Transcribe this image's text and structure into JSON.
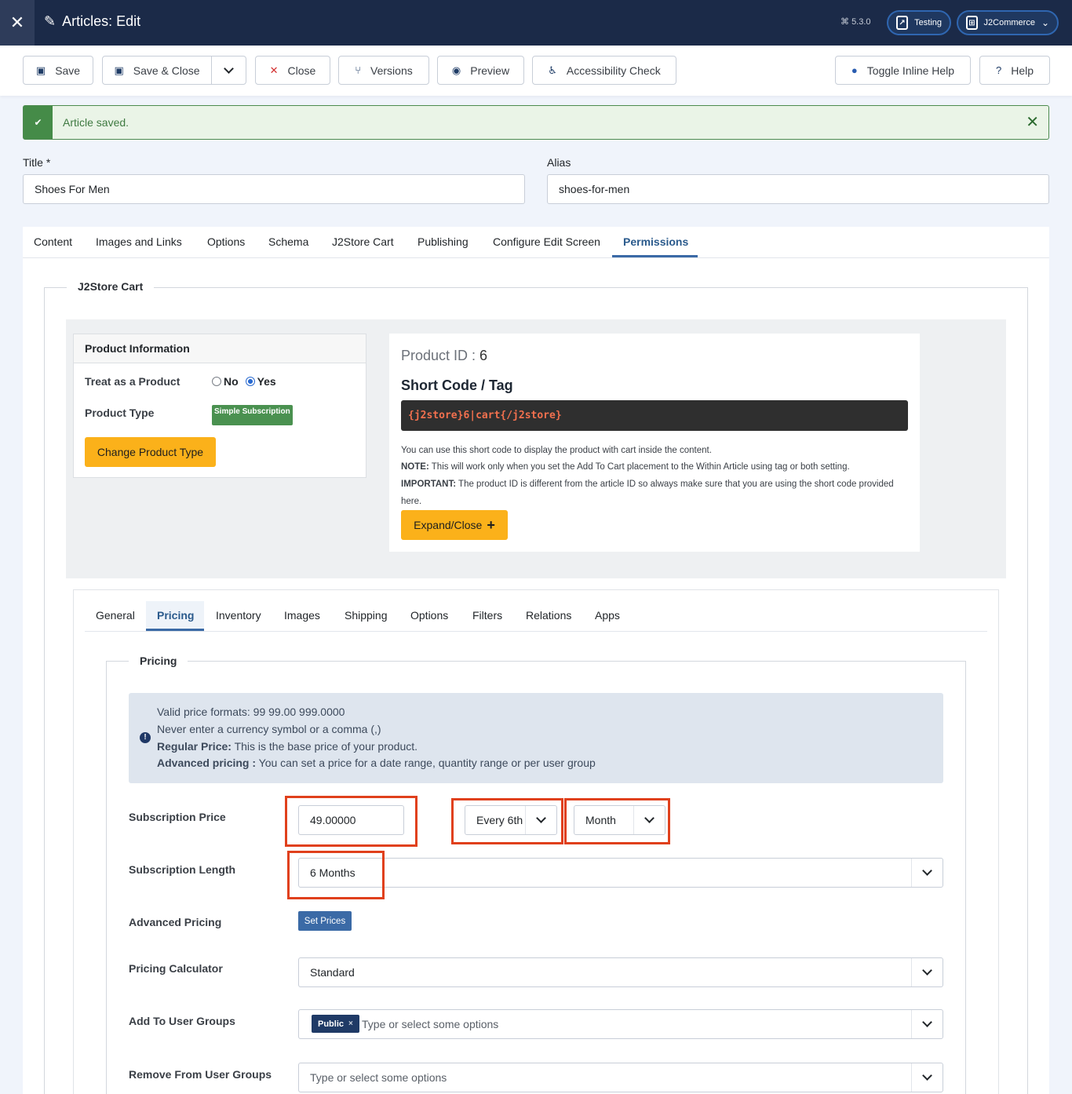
{
  "header": {
    "title": "Articles: Edit",
    "version": "5.3.0",
    "site_button": "Testing",
    "user_menu": "J2Commerce"
  },
  "toolbar": {
    "save": "Save",
    "save_close": "Save & Close",
    "close": "Close",
    "versions": "Versions",
    "preview": "Preview",
    "accessibility": "Accessibility Check",
    "inline_help": "Toggle Inline Help",
    "help": "Help"
  },
  "alert": {
    "message": "Article saved."
  },
  "form": {
    "title_label": "Title *",
    "title_value": "Shoes For Men",
    "alias_label": "Alias",
    "alias_value": "shoes-for-men"
  },
  "tabs": [
    "Content",
    "Images and Links",
    "Options",
    "Schema",
    "J2Store Cart",
    "Publishing",
    "Configure Edit Screen",
    "Permissions"
  ],
  "j2store": {
    "legend": "J2Store Cart",
    "product_info": {
      "heading": "Product Information",
      "treat_label": "Treat as a Product",
      "no": "No",
      "yes": "Yes",
      "type_label": "Product Type",
      "type_value": "Simple Subscription",
      "change_button": "Change Product Type"
    },
    "shortcode": {
      "product_id_label": "Product ID : ",
      "product_id": "6",
      "heading": "Short Code / Tag",
      "code": "{j2store}6|cart{/j2store}",
      "line1": "You can use this short code to display the product with cart inside the content.",
      "note_label": "NOTE:",
      "note": " This will work only when you set the Add To Cart placement to the Within Article using tag or both setting.",
      "important_label": "IMPORTANT:",
      "important": " The product ID is different from the article ID so always make sure that you are using the short code provided",
      "important_cont": "here.",
      "expand_button": "Expand/Close"
    }
  },
  "subtabs": [
    "General",
    "Pricing",
    "Inventory",
    "Images",
    "Shipping",
    "Options",
    "Filters",
    "Relations",
    "Apps"
  ],
  "pricing": {
    "legend": "Pricing",
    "info": {
      "line1": "Valid price formats: 99 99.00 999.0000",
      "line2": "Never enter a currency symbol or a comma (,)",
      "line3_bold": "Regular Price:",
      "line3": " This is the base price of your product.",
      "line4_bold": "Advanced pricing :",
      "line4": " You can set a price for a date range, quantity range or per user group"
    },
    "subscription_price_label": "Subscription Price",
    "subscription_price": "49.00000",
    "interval": "Every 6th",
    "period": "Month",
    "subscription_length_label": "Subscription Length",
    "subscription_length": "6 Months",
    "advanced_pricing_label": "Advanced Pricing",
    "set_prices": "Set Prices",
    "calculator_label": "Pricing Calculator",
    "calculator": "Standard",
    "add_groups_label": "Add To User Groups",
    "add_groups_tag": "Public",
    "add_groups_placeholder": "Type or select some options",
    "remove_groups_label": "Remove From User Groups",
    "remove_groups_placeholder": "Type or select some options"
  }
}
